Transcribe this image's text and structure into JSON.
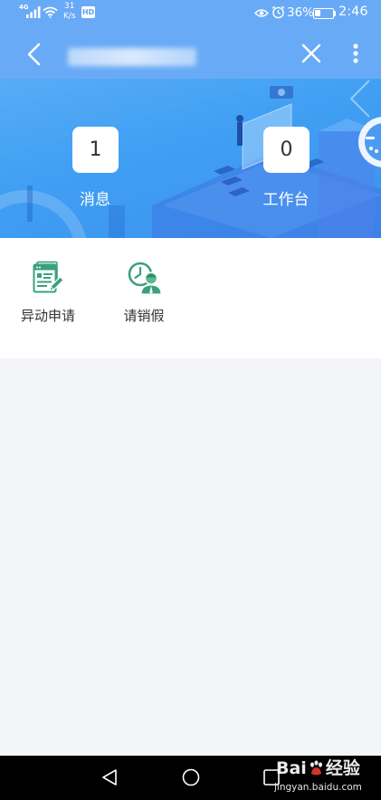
{
  "status_bar": {
    "network_type": "4G",
    "speed_value": "31",
    "speed_unit": "K/s",
    "hd_label": "HD",
    "battery_percent": "36%",
    "battery_level": 0.36,
    "time": "2:46",
    "left_icons": [
      "signal-icon",
      "wifi-icon"
    ],
    "right_icons": [
      "eye-icon",
      "alarm-icon",
      "battery-icon"
    ]
  },
  "header": {
    "back_icon": "chevron-left-icon",
    "close_icon": "close-icon",
    "more_icon": "more-vertical-icon"
  },
  "banner": {
    "stats": [
      {
        "value": "1",
        "label": "消息"
      },
      {
        "value": "0",
        "label": "工作台"
      }
    ]
  },
  "quick_actions": [
    {
      "label": "异动申请",
      "icon": "document-edit-icon"
    },
    {
      "label": "请销假",
      "icon": "clock-person-icon"
    }
  ],
  "nav_bar": {
    "icons": [
      "back-triangle-icon",
      "home-circle-icon",
      "recents-square-icon"
    ]
  },
  "watermark": {
    "brand_prefix": "Bai",
    "brand_suffix": "经验",
    "url": "jingyan.baidu.com"
  },
  "colors": {
    "header_bg": "#69aaf6",
    "banner_bg": "#3f9bf2",
    "accent_green": "#3aa17d",
    "content_bg": "#f4f5f9",
    "nav_bg": "#000000"
  }
}
